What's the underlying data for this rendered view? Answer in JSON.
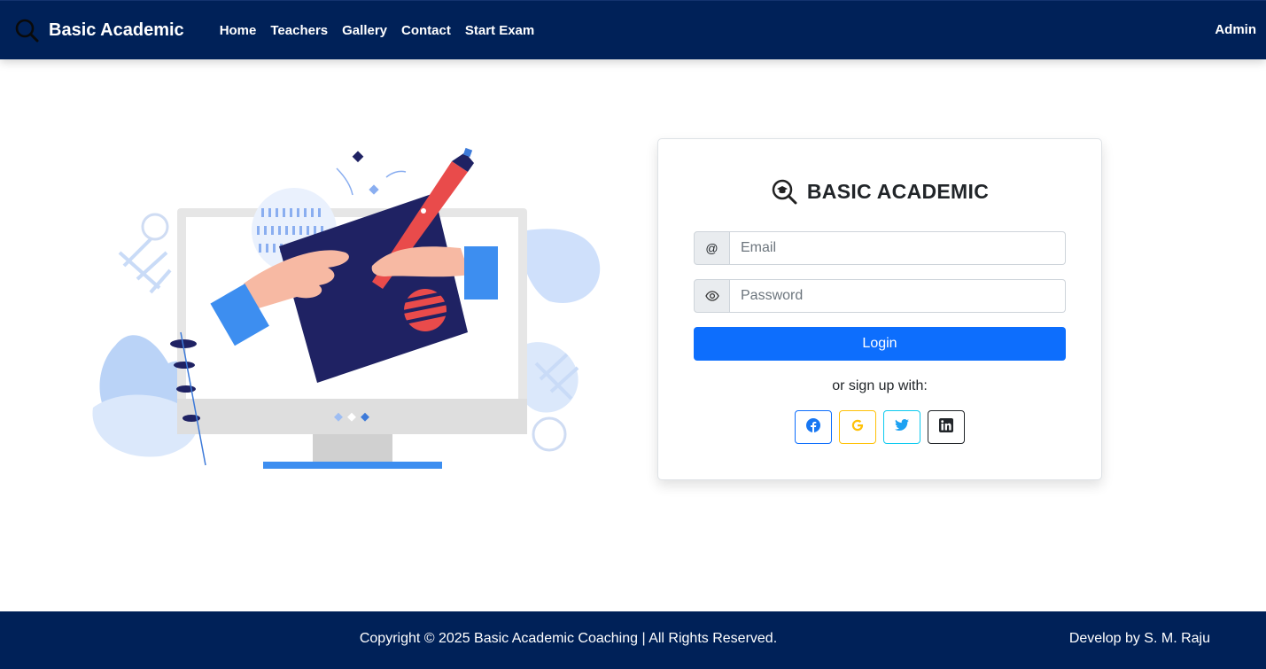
{
  "navbar": {
    "brand": "Basic Academic",
    "links": [
      "Home",
      "Teachers",
      "Gallery",
      "Contact",
      "Start Exam"
    ],
    "admin": "Admin"
  },
  "login": {
    "title": "BASIC ACADEMIC",
    "email_addon": "@",
    "email_placeholder": "Email",
    "password_placeholder": "Password",
    "login_label": "Login",
    "signup_text": "or sign up with:",
    "social": [
      "facebook-icon",
      "google-icon",
      "twitter-icon",
      "linkedin-icon"
    ]
  },
  "footer": {
    "copyright": "Copyright © 2025 Basic Academic Coaching | All Rights Reserved.",
    "developer": "Develop by S. M. Raju"
  },
  "colors": {
    "navbar_bg": "#002158",
    "primary": "#0d6efd",
    "facebook": "#1877f2",
    "google": "#ffc107",
    "twitter": "#1da1f2",
    "linkedin": "#212529"
  }
}
